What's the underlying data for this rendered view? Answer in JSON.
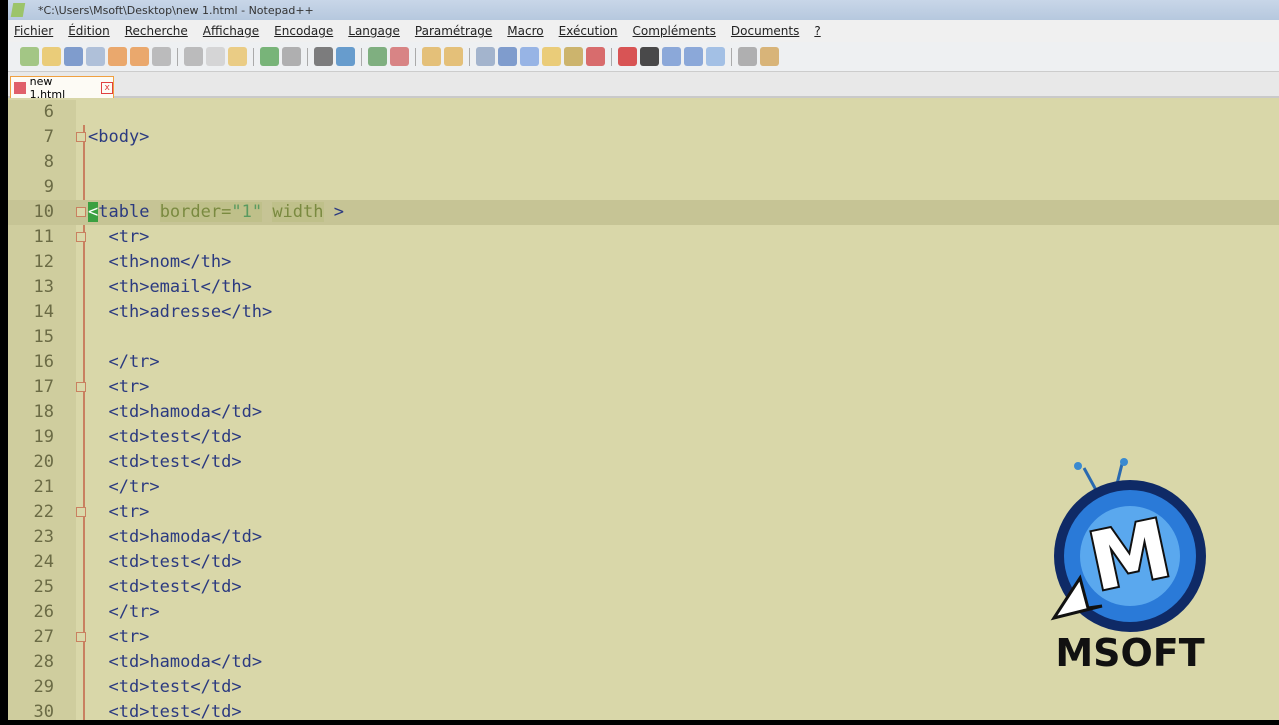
{
  "window": {
    "title": "*C:\\Users\\Msoft\\Desktop\\new 1.html - Notepad++"
  },
  "menu": [
    "Fichier",
    "Édition",
    "Recherche",
    "Affichage",
    "Encodage",
    "Langage",
    "Paramétrage",
    "Macro",
    "Exécution",
    "Compléments",
    "Documents",
    "?"
  ],
  "tab": {
    "label": "new 1.html",
    "close": "x"
  },
  "editor": {
    "lines": [
      {
        "n": "6",
        "code": ""
      },
      {
        "n": "7",
        "code": "<body>",
        "fold": true
      },
      {
        "n": "8",
        "code": ""
      },
      {
        "n": "9",
        "code": ""
      },
      {
        "n": "10",
        "code": "<table border=\"1\" width >",
        "fold": true,
        "current": true
      },
      {
        "n": "11",
        "code": "  <tr>",
        "fold": true
      },
      {
        "n": "12",
        "code": "  <th>nom</th>"
      },
      {
        "n": "13",
        "code": "  <th>email</th>"
      },
      {
        "n": "14",
        "code": "  <th>adresse</th>"
      },
      {
        "n": "15",
        "code": ""
      },
      {
        "n": "16",
        "code": "  </tr>"
      },
      {
        "n": "17",
        "code": "  <tr>",
        "fold": true
      },
      {
        "n": "18",
        "code": "  <td>hamoda</td>"
      },
      {
        "n": "19",
        "code": "  <td>test</td>"
      },
      {
        "n": "20",
        "code": "  <td>test</td>"
      },
      {
        "n": "21",
        "code": "  </tr>"
      },
      {
        "n": "22",
        "code": "  <tr>",
        "fold": true
      },
      {
        "n": "23",
        "code": "  <td>hamoda</td>"
      },
      {
        "n": "24",
        "code": "  <td>test</td>"
      },
      {
        "n": "25",
        "code": "  <td>test</td>"
      },
      {
        "n": "26",
        "code": "  </tr>"
      },
      {
        "n": "27",
        "code": "  <tr>",
        "fold": true
      },
      {
        "n": "28",
        "code": "  <td>hamoda</td>"
      },
      {
        "n": "29",
        "code": "  <td>test</td>"
      },
      {
        "n": "30",
        "code": "  <td>test</td>"
      }
    ]
  },
  "watermark": {
    "text": "MSOFT",
    "letter": "M"
  }
}
